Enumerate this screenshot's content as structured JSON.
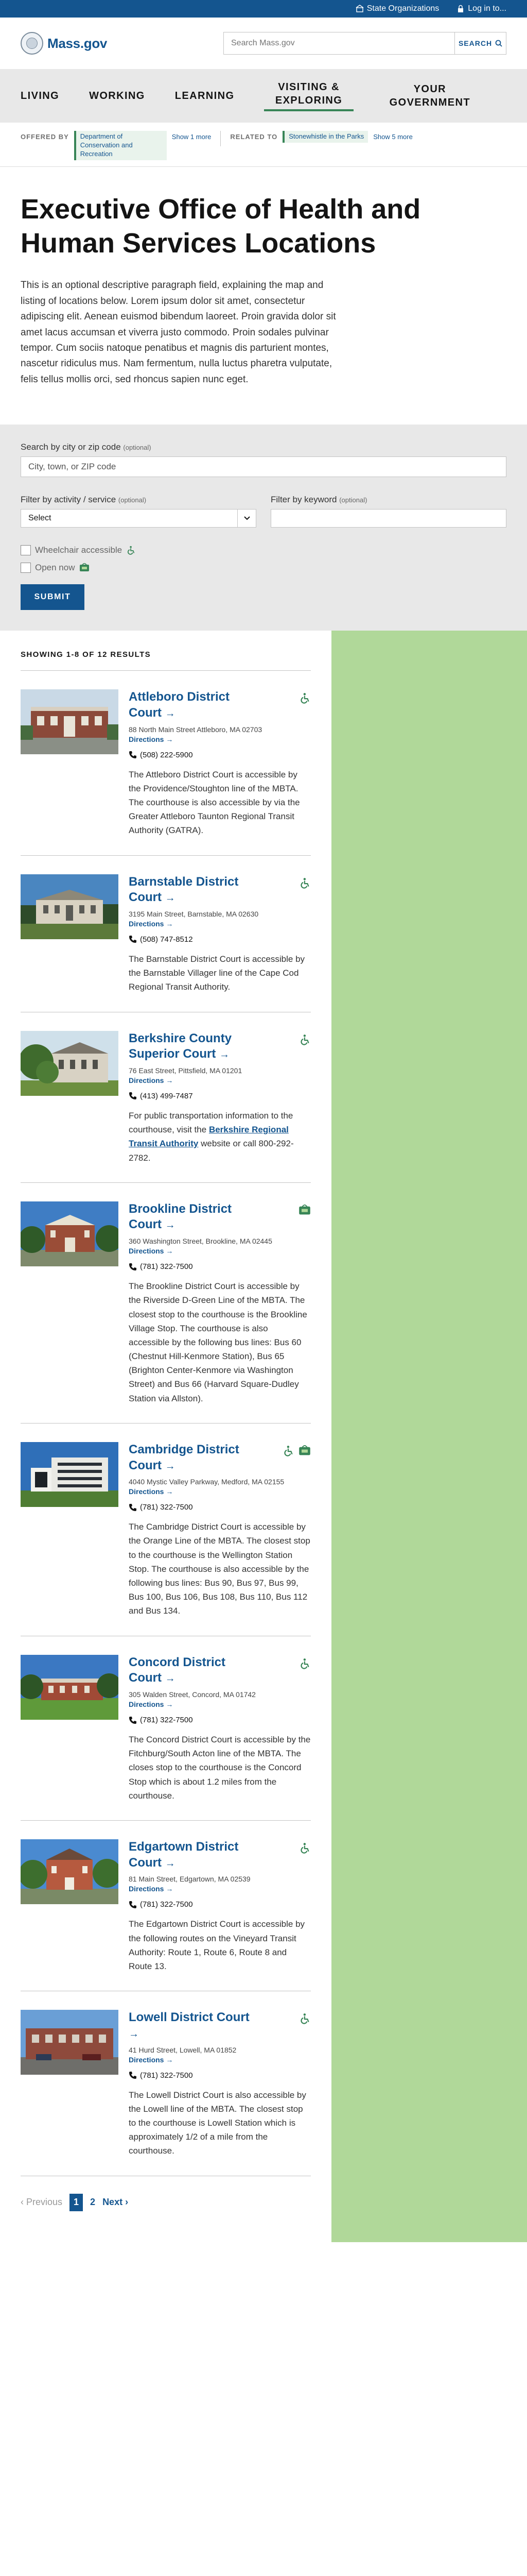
{
  "utility": {
    "state_orgs": "State Organizations",
    "login": "Log in to..."
  },
  "header": {
    "logo_text": "Mass.gov",
    "search_placeholder": "Search Mass.gov",
    "search_button": "SEARCH"
  },
  "nav": {
    "items": [
      "LIVING",
      "WORKING",
      "LEARNING",
      "VISITING & EXPLORING",
      "YOUR GOVERNMENT"
    ]
  },
  "relationships": {
    "offered_label": "OFFERED BY",
    "offered_org": "Department of Conservation and Recreation",
    "offered_more": "Show 1 more",
    "related_label": "RELATED TO",
    "related_org": "Stonewhistle in the Parks",
    "related_more": "Show 5 more"
  },
  "page": {
    "title": "Executive Office of Health and Human Services Locations",
    "description": "This is an optional descriptive paragraph field, explaining the map and listing of locations below. Lorem ipsum dolor sit amet, consectetur adipiscing elit. Aenean euismod bibendum laoreet. Proin gravida dolor sit amet lacus accumsan et viverra justo commodo. Proin sodales pulvinar tempor. Cum sociis natoque penatibus et magnis dis parturient montes, nascetur ridiculus mus. Nam fermentum, nulla luctus pharetra vulputate, felis tellus mollis orci, sed rhoncus sapien nunc eget."
  },
  "filters": {
    "location_label": "Search by city or zip code",
    "location_optional": "(optional)",
    "location_placeholder": "City, town, or ZIP code",
    "activity_label": "Filter by activity / service",
    "activity_optional": "(optional)",
    "activity_value": "Select",
    "keyword_label": "Filter by keyword",
    "keyword_optional": "(optional)",
    "wheelchair_label": "Wheelchair accessible",
    "open_label": "Open now",
    "submit_label": "SUBMIT"
  },
  "results": {
    "count_label": "SHOWING 1-8 OF 12 RESULTS",
    "directions_label": "Directions",
    "items": [
      {
        "title": "Attleboro District Court",
        "address": "88 North Main Street Attleboro, MA 02703",
        "phone": "(508) 222-5900",
        "description": "The Attleboro District Court is accessible by the Providence/Stoughton line of the MBTA. The courthouse is also accessible by via the Greater Attleboro Taunton Regional Transit Authority (GATRA).",
        "badges": [
          "wheelchair-icon"
        ]
      },
      {
        "title": "Barnstable District Court",
        "address": "3195 Main Street, Barnstable, MA 02630",
        "phone": "(508) 747-8512",
        "description": "The Barnstable District Court is accessible by the Barnstable Villager line of the Cape Cod Regional Transit Authority.",
        "badges": [
          "wheelchair-icon"
        ]
      },
      {
        "title": "Berkshire County Superior Court",
        "address": "76 East Street, Pittsfield, MA 01201",
        "phone": "(413) 499-7487",
        "description": "For public transportation information to the courthouse, visit the",
        "link_text": "Berkshire Regional Transit Authority",
        "description_after": "website or call 800-292-2782.",
        "badges": [
          "wheelchair-icon"
        ]
      },
      {
        "title": "Brookline District Court",
        "address": "360 Washington Street, Brookline, MA 02445",
        "phone": "(781) 322-7500",
        "description": "The Brookline District Court is accessible by the Riverside D-Green Line of the MBTA. The closest stop to the courthouse is the Brookline Village Stop. The courthouse is also accessible by the following bus lines: Bus 60 (Chestnut Hill-Kenmore Station), Bus 65 (Brighton Center-Kenmore via Washington Street) and Bus 66 (Harvard Square-Dudley Station via Allston).",
        "badges": [
          "open-icon"
        ]
      },
      {
        "title": "Cambridge District Court",
        "address": "4040 Mystic Valley Parkway, Medford, MA 02155",
        "phone": "(781) 322-7500",
        "description": "The Cambridge District Court is accessible by the Orange Line of the MBTA. The closest stop to the courthouse is the Wellington Station Stop. The courthouse is also accessible by the following bus lines: Bus 90, Bus 97, Bus 99, Bus 100, Bus 106, Bus 108, Bus 110, Bus 112 and Bus 134.",
        "badges": [
          "wheelchair-icon",
          "open-icon"
        ]
      },
      {
        "title": "Concord District Court",
        "address": "305 Walden Street, Concord, MA 01742",
        "phone": "(781) 322-7500",
        "description": "The Concord District Court is accessible by the Fitchburg/South Acton line of the MBTA. The closes stop to the courthouse is the Concord Stop which is about 1.2 miles from the courthouse.",
        "badges": [
          "wheelchair-icon"
        ]
      },
      {
        "title": "Edgartown District Court",
        "address": "81 Main Street, Edgartown, MA 02539",
        "phone": "(781) 322-7500",
        "description": "The Edgartown District Court is accessible by the following routes on the Vineyard Transit Authority: Route 1, Route 6, Route 8 and Route 13.",
        "badges": [
          "wheelchair-icon"
        ]
      },
      {
        "title": "Lowell District Court",
        "address": "41 Hurd Street, Lowell, MA 01852",
        "phone": "(781) 322-7500",
        "description": "The Lowell District Court is also accessible by the Lowell line of the MBTA. The closest stop to the courthouse is Lowell Station which is approximately 1/2 of a mile from the courthouse.",
        "badges": [
          "wheelchair-icon"
        ]
      }
    ]
  },
  "pagination": {
    "previous": "Previous",
    "pages": [
      "1",
      "2"
    ],
    "next": "Next"
  }
}
